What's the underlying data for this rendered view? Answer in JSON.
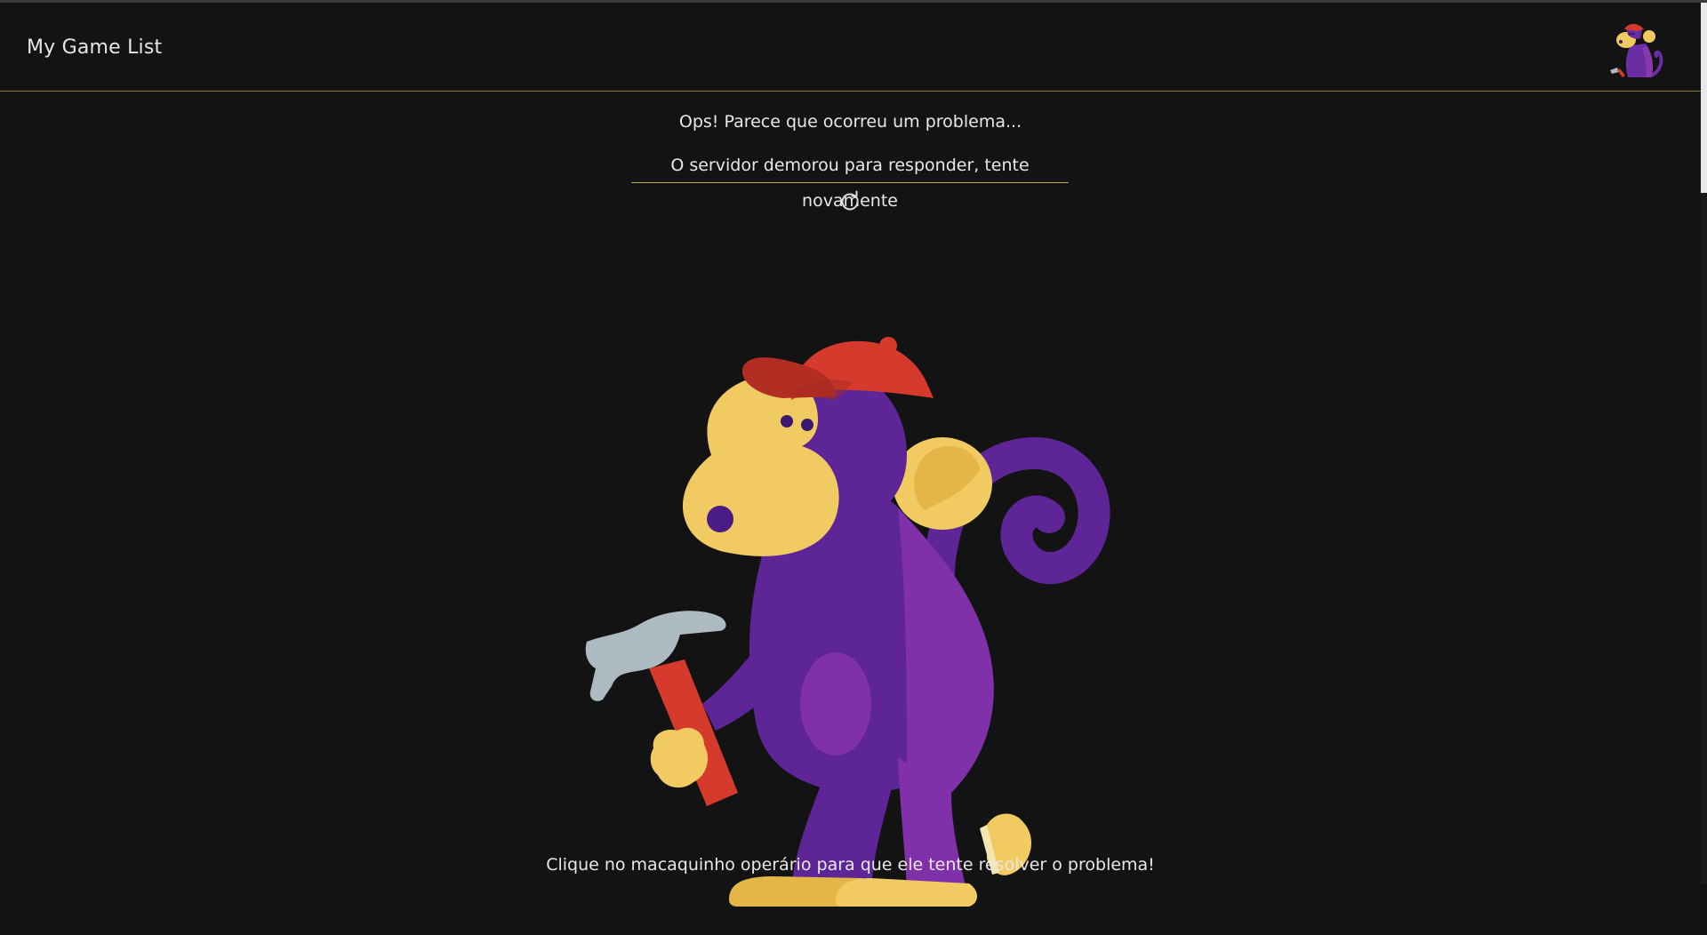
{
  "header": {
    "app_title": "My Game List",
    "avatar_icon": "monkey-avatar-icon"
  },
  "error": {
    "title": "Ops! Parece que ocorreu um problema...",
    "message": "O servidor demorou para responder, tente novamente",
    "retry_icon": "refresh-icon",
    "illustration": "worker-monkey-icon",
    "hint": "Clique no macaquinho operário para que ele tente resolver o problema!"
  },
  "colors": {
    "background": "#131313",
    "accent": "#b8a848",
    "monkey_purple": "#5e2596",
    "monkey_light_purple": "#8030a8",
    "monkey_yellow": "#f1cb62",
    "hat_red": "#d63a2d",
    "hammer_gray": "#aebac2"
  }
}
